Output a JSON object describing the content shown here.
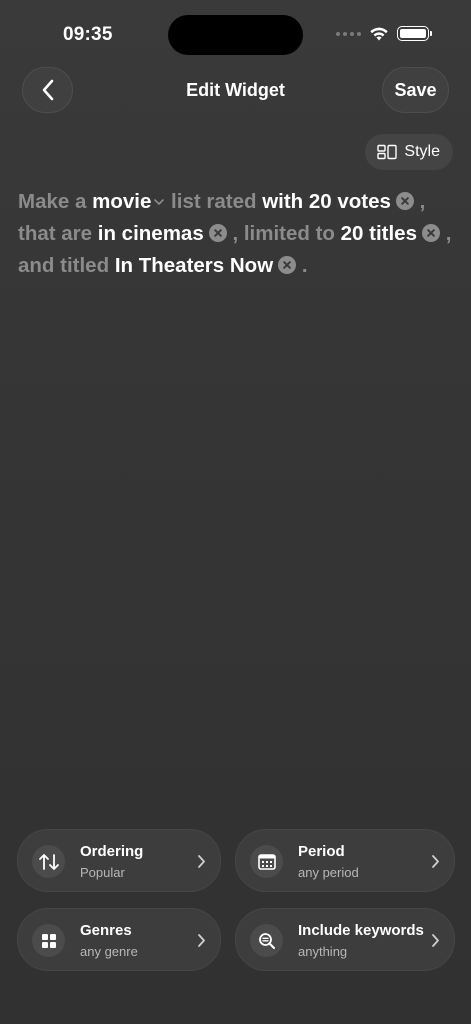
{
  "status_bar": {
    "time": "09:35"
  },
  "nav": {
    "title": "Edit Widget",
    "save_label": "Save"
  },
  "style_button": {
    "label": "Style"
  },
  "sentence": {
    "make_a": "Make a",
    "media_type": "movie",
    "list_rated": "list rated",
    "votes": "with 20 votes",
    "that_are": ", that are",
    "availability": "in cinemas",
    "limited_to": ", limited to",
    "limit": "20 titles",
    "and_titled": ", and titled",
    "title": "In Theaters Now",
    "end": "."
  },
  "options": [
    {
      "label": "Ordering",
      "value": "Popular",
      "icon": "sort-arrows-icon"
    },
    {
      "label": "Period",
      "value": "any period",
      "icon": "calendar-icon"
    },
    {
      "label": "Genres",
      "value": "any genre",
      "icon": "grid-icon"
    },
    {
      "label": "Include keywords",
      "value": "anything",
      "icon": "search-text-icon"
    }
  ],
  "colors": {
    "background": "#353535",
    "muted_text": "#8b8b8b",
    "card": "#3d3d3d"
  }
}
